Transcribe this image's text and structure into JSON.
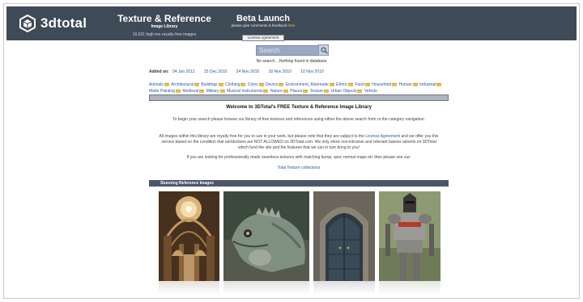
{
  "header": {
    "logo_text": "3dtotal",
    "library_title": "Texture & Reference",
    "library_subtitle": "Image Library",
    "image_count": "16,631 high-res royalty-free images",
    "beta_title": "Beta Launch",
    "beta_note_prefix": "please give comments & feedback",
    "beta_note_link": "here",
    "license_button": "License Agreement"
  },
  "search": {
    "placeholder": "Search",
    "no_results": "No search ...Nothing found in database"
  },
  "added_on": {
    "label": "Added on:",
    "dates": [
      "04 Jan 2012",
      "15 Dec 2010",
      "24 Nov 2010",
      "18 Nov 2010",
      "10 Nov 2010"
    ]
  },
  "categories": [
    "Animals",
    "Architectural",
    "Buildings",
    "Clothing",
    "Coins",
    "Device",
    "Environment_Manmade",
    "Ethnic",
    "Food",
    "Household",
    "Human",
    "Industrial",
    "Matte Painting",
    "Medieval",
    "Military",
    "Musical Instruments",
    "Nature",
    "Places",
    "Texture",
    "Urban Objects",
    "Vehicle"
  ],
  "welcome": {
    "title": "Welcome to 3DTotal's FREE Texture & Reference Image Library",
    "p1": "To begin your search please browse our library of free textures and references using either the above search form or the category navigation.",
    "p2_before": "All images within this library are royalty free for you to use in your work, but please note that they are subject to the",
    "p2_link": "License Agreement",
    "p2_after": "and we offer you this service based on the condition that ad-blockers are NOT ALLOWED on 3DTotal.com. We only show non-intrusive and relevant banner adverts on 3DTotal which fund the site and the features that we can in turn bring to you!",
    "p3": "If you are looking for professionally made seamless textures with matching bump, spec normal maps etc then please see our:",
    "texture_link": "Total Texture collections"
  },
  "gallery": {
    "title": "Stunning Reference Images",
    "images": [
      "cathedral-dome",
      "iguana",
      "arched-door",
      "armored-knight"
    ]
  },
  "colors": {
    "header_bg": "#3f4a57",
    "link": "#2c56a8",
    "folder": "#e8c34b",
    "gallery_bar": "#4b5768"
  }
}
